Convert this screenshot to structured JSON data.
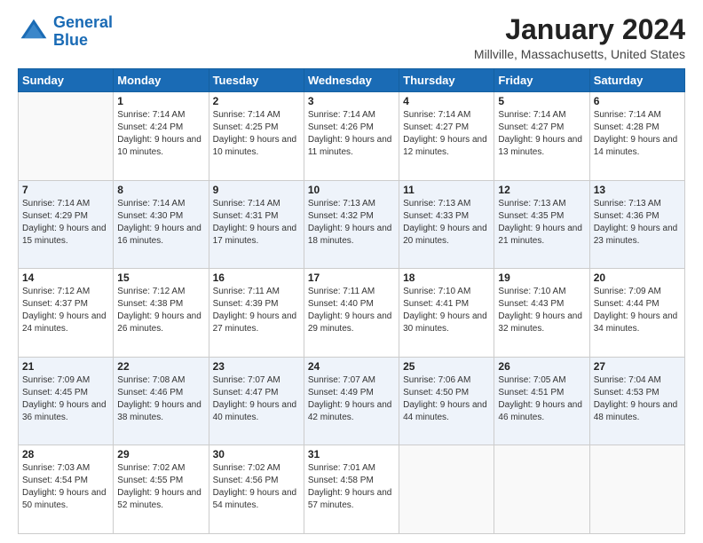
{
  "logo": {
    "line1": "General",
    "line2": "Blue"
  },
  "title": "January 2024",
  "location": "Millville, Massachusetts, United States",
  "days_of_week": [
    "Sunday",
    "Monday",
    "Tuesday",
    "Wednesday",
    "Thursday",
    "Friday",
    "Saturday"
  ],
  "weeks": [
    [
      {
        "day": "",
        "empty": true
      },
      {
        "day": "1",
        "sunrise": "Sunrise: 7:14 AM",
        "sunset": "Sunset: 4:24 PM",
        "daylight": "Daylight: 9 hours and 10 minutes."
      },
      {
        "day": "2",
        "sunrise": "Sunrise: 7:14 AM",
        "sunset": "Sunset: 4:25 PM",
        "daylight": "Daylight: 9 hours and 10 minutes."
      },
      {
        "day": "3",
        "sunrise": "Sunrise: 7:14 AM",
        "sunset": "Sunset: 4:26 PM",
        "daylight": "Daylight: 9 hours and 11 minutes."
      },
      {
        "day": "4",
        "sunrise": "Sunrise: 7:14 AM",
        "sunset": "Sunset: 4:27 PM",
        "daylight": "Daylight: 9 hours and 12 minutes."
      },
      {
        "day": "5",
        "sunrise": "Sunrise: 7:14 AM",
        "sunset": "Sunset: 4:27 PM",
        "daylight": "Daylight: 9 hours and 13 minutes."
      },
      {
        "day": "6",
        "sunrise": "Sunrise: 7:14 AM",
        "sunset": "Sunset: 4:28 PM",
        "daylight": "Daylight: 9 hours and 14 minutes."
      }
    ],
    [
      {
        "day": "7",
        "sunrise": "Sunrise: 7:14 AM",
        "sunset": "Sunset: 4:29 PM",
        "daylight": "Daylight: 9 hours and 15 minutes."
      },
      {
        "day": "8",
        "sunrise": "Sunrise: 7:14 AM",
        "sunset": "Sunset: 4:30 PM",
        "daylight": "Daylight: 9 hours and 16 minutes."
      },
      {
        "day": "9",
        "sunrise": "Sunrise: 7:14 AM",
        "sunset": "Sunset: 4:31 PM",
        "daylight": "Daylight: 9 hours and 17 minutes."
      },
      {
        "day": "10",
        "sunrise": "Sunrise: 7:13 AM",
        "sunset": "Sunset: 4:32 PM",
        "daylight": "Daylight: 9 hours and 18 minutes."
      },
      {
        "day": "11",
        "sunrise": "Sunrise: 7:13 AM",
        "sunset": "Sunset: 4:33 PM",
        "daylight": "Daylight: 9 hours and 20 minutes."
      },
      {
        "day": "12",
        "sunrise": "Sunrise: 7:13 AM",
        "sunset": "Sunset: 4:35 PM",
        "daylight": "Daylight: 9 hours and 21 minutes."
      },
      {
        "day": "13",
        "sunrise": "Sunrise: 7:13 AM",
        "sunset": "Sunset: 4:36 PM",
        "daylight": "Daylight: 9 hours and 23 minutes."
      }
    ],
    [
      {
        "day": "14",
        "sunrise": "Sunrise: 7:12 AM",
        "sunset": "Sunset: 4:37 PM",
        "daylight": "Daylight: 9 hours and 24 minutes."
      },
      {
        "day": "15",
        "sunrise": "Sunrise: 7:12 AM",
        "sunset": "Sunset: 4:38 PM",
        "daylight": "Daylight: 9 hours and 26 minutes."
      },
      {
        "day": "16",
        "sunrise": "Sunrise: 7:11 AM",
        "sunset": "Sunset: 4:39 PM",
        "daylight": "Daylight: 9 hours and 27 minutes."
      },
      {
        "day": "17",
        "sunrise": "Sunrise: 7:11 AM",
        "sunset": "Sunset: 4:40 PM",
        "daylight": "Daylight: 9 hours and 29 minutes."
      },
      {
        "day": "18",
        "sunrise": "Sunrise: 7:10 AM",
        "sunset": "Sunset: 4:41 PM",
        "daylight": "Daylight: 9 hours and 30 minutes."
      },
      {
        "day": "19",
        "sunrise": "Sunrise: 7:10 AM",
        "sunset": "Sunset: 4:43 PM",
        "daylight": "Daylight: 9 hours and 32 minutes."
      },
      {
        "day": "20",
        "sunrise": "Sunrise: 7:09 AM",
        "sunset": "Sunset: 4:44 PM",
        "daylight": "Daylight: 9 hours and 34 minutes."
      }
    ],
    [
      {
        "day": "21",
        "sunrise": "Sunrise: 7:09 AM",
        "sunset": "Sunset: 4:45 PM",
        "daylight": "Daylight: 9 hours and 36 minutes."
      },
      {
        "day": "22",
        "sunrise": "Sunrise: 7:08 AM",
        "sunset": "Sunset: 4:46 PM",
        "daylight": "Daylight: 9 hours and 38 minutes."
      },
      {
        "day": "23",
        "sunrise": "Sunrise: 7:07 AM",
        "sunset": "Sunset: 4:47 PM",
        "daylight": "Daylight: 9 hours and 40 minutes."
      },
      {
        "day": "24",
        "sunrise": "Sunrise: 7:07 AM",
        "sunset": "Sunset: 4:49 PM",
        "daylight": "Daylight: 9 hours and 42 minutes."
      },
      {
        "day": "25",
        "sunrise": "Sunrise: 7:06 AM",
        "sunset": "Sunset: 4:50 PM",
        "daylight": "Daylight: 9 hours and 44 minutes."
      },
      {
        "day": "26",
        "sunrise": "Sunrise: 7:05 AM",
        "sunset": "Sunset: 4:51 PM",
        "daylight": "Daylight: 9 hours and 46 minutes."
      },
      {
        "day": "27",
        "sunrise": "Sunrise: 7:04 AM",
        "sunset": "Sunset: 4:53 PM",
        "daylight": "Daylight: 9 hours and 48 minutes."
      }
    ],
    [
      {
        "day": "28",
        "sunrise": "Sunrise: 7:03 AM",
        "sunset": "Sunset: 4:54 PM",
        "daylight": "Daylight: 9 hours and 50 minutes."
      },
      {
        "day": "29",
        "sunrise": "Sunrise: 7:02 AM",
        "sunset": "Sunset: 4:55 PM",
        "daylight": "Daylight: 9 hours and 52 minutes."
      },
      {
        "day": "30",
        "sunrise": "Sunrise: 7:02 AM",
        "sunset": "Sunset: 4:56 PM",
        "daylight": "Daylight: 9 hours and 54 minutes."
      },
      {
        "day": "31",
        "sunrise": "Sunrise: 7:01 AM",
        "sunset": "Sunset: 4:58 PM",
        "daylight": "Daylight: 9 hours and 57 minutes."
      },
      {
        "day": "",
        "empty": true
      },
      {
        "day": "",
        "empty": true
      },
      {
        "day": "",
        "empty": true
      }
    ]
  ]
}
